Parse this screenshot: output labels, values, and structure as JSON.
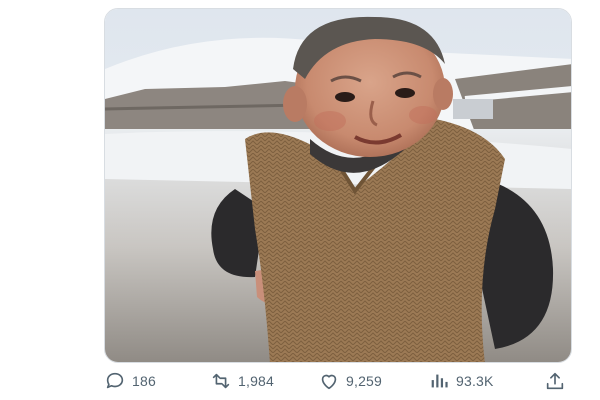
{
  "post": {
    "media": {
      "image": "photo-of-child-in-knitted-vest-in-snow"
    },
    "actions": {
      "reply_count": "186",
      "retweet_count": "1,984",
      "like_count": "9,259",
      "view_count": "93.3K"
    },
    "icons": {
      "reply": "reply-icon",
      "retweet": "retweet-icon",
      "like": "heart-icon",
      "views": "views-chart-icon",
      "share": "share-icon"
    },
    "colors": {
      "icon_gray": "#536471",
      "card_border": "#d8dde2"
    }
  }
}
